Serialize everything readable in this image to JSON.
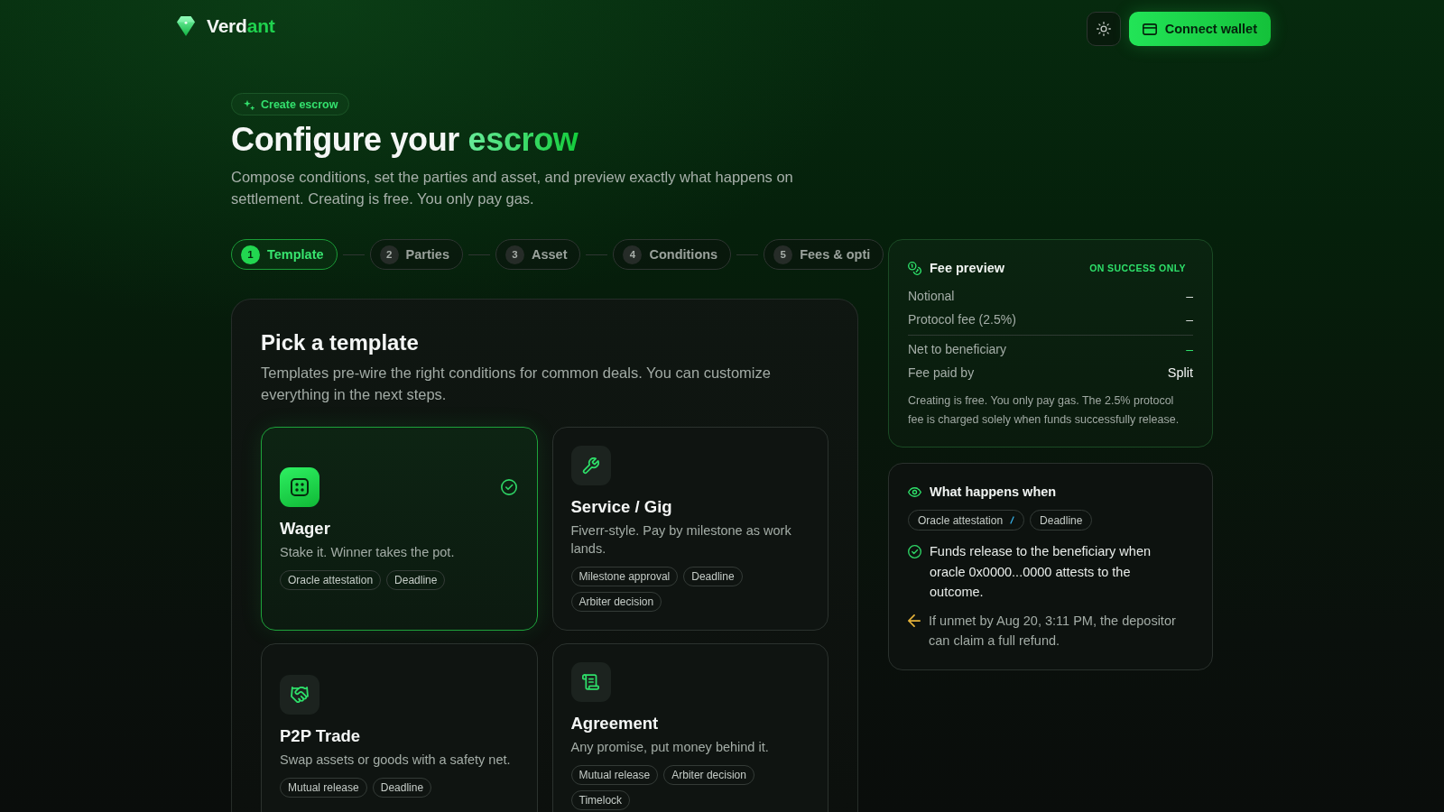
{
  "header": {
    "brand": {
      "name": "Verd",
      "accent": "ant"
    },
    "connect_button": {
      "label": "Connect wallet"
    }
  },
  "hero": {
    "badge": "Create escrow",
    "title": "Configure your",
    "title_accent": "escrow",
    "subtitle": "Compose conditions, set the parties and asset, and preview exactly what happens on settlement. Creating is free. You only pay gas."
  },
  "stepper": [
    {
      "number": "1",
      "label": "Template",
      "selected": true
    },
    {
      "number": "2",
      "label": "Parties",
      "selected": false
    },
    {
      "number": "3",
      "label": "Asset",
      "selected": false
    },
    {
      "number": "4",
      "label": "Conditions",
      "selected": false
    },
    {
      "number": "5",
      "label": "Fees & opti",
      "selected": false
    }
  ],
  "template_picker": {
    "title": "Pick a template",
    "description": "Templates pre-wire the right conditions for common deals. You can customize everything in the next steps.",
    "templates": [
      {
        "kind": "dice",
        "name": "Wager",
        "description": "Stake it. Winner takes the pot.",
        "selected": true,
        "tags": [
          "Oracle attestation",
          "Deadline"
        ]
      },
      {
        "kind": "wrench",
        "name": "Service / Gig",
        "description": "Fiverr-style. Pay by milestone as work lands.",
        "selected": false,
        "tags": [
          "Milestone approval",
          "Deadline",
          "Arbiter decision"
        ]
      },
      {
        "kind": "handshake",
        "name": "P2P Trade",
        "description": "Swap assets or goods with a safety net.",
        "selected": false,
        "tags": [
          "Mutual release",
          "Deadline"
        ]
      },
      {
        "kind": "scroll",
        "name": "Agreement",
        "description": "Any promise, put money behind it.",
        "selected": false,
        "tags": [
          "Mutual release",
          "Arbiter decision",
          "Timelock"
        ]
      }
    ]
  },
  "fee_preview": {
    "title": "Fee preview",
    "badge": "ON SUCCESS ONLY",
    "rows": [
      {
        "kind": "amount",
        "label": "Notional",
        "value": "–"
      },
      {
        "kind": "amount",
        "label": "Protocol fee (2.5%)",
        "value": "–"
      },
      {
        "kind": "net",
        "label": "Net to beneficiary",
        "value": "–"
      },
      {
        "kind": "setting",
        "label": "Fee paid by",
        "value": "Split"
      }
    ],
    "note": "Creating is free. You only pay gas. The 2.5% protocol fee is charged solely when funds successfully release."
  },
  "what_happens": {
    "title": "What happens when",
    "chips": [
      {
        "kind": "joined",
        "label": "Oracle attestation"
      },
      {
        "kind": "plain",
        "label": "Deadline"
      }
    ],
    "outcomes": [
      {
        "kind": "release",
        "text": "Funds release to the beneficiary when oracle 0x0000...0000 attests to the outcome."
      },
      {
        "kind": "refund",
        "text": "If unmet by Aug 20, 3:11 PM, the depositor can claim a full refund."
      }
    ]
  }
}
